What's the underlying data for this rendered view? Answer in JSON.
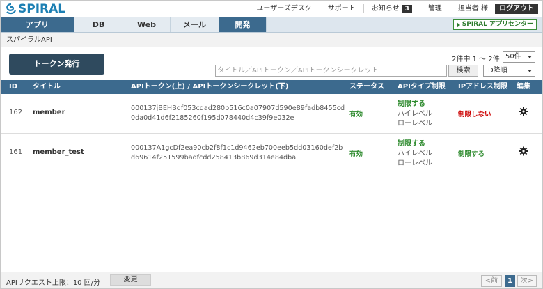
{
  "header": {
    "logo_text": "SPIRAL",
    "nav": {
      "user_desk": "ユーザーズデスク",
      "support": "サポート",
      "notice": "お知らせ",
      "notice_count": "3",
      "admin": "管理",
      "assignee": "担当者 様",
      "logout": "ログアウト"
    }
  },
  "mainnav": {
    "tabs": [
      {
        "label": "アプリ"
      },
      {
        "label": "DB"
      },
      {
        "label": "Web"
      },
      {
        "label": "メール"
      },
      {
        "label": "開発"
      }
    ],
    "app_center": "SPIRAL アプリセンター"
  },
  "breadcrumb": "スパイラルAPI",
  "toolbar": {
    "issue_token": "トークン発行",
    "count_text": "2件中 1 ～ 2件",
    "per_page": "50件",
    "search_placeholder": "タイトル／APIトークン／APIトークンシークレット",
    "search_button": "検索",
    "sort": "ID降順"
  },
  "table": {
    "headers": {
      "id": "ID",
      "title": "タイトル",
      "token": "APIトークン(上) / APIトークンシークレット(下)",
      "status": "ステータス",
      "api_type": "APIタイプ制限",
      "ip": "IPアドレス制限",
      "edit": "編集"
    },
    "rows": [
      {
        "id": "162",
        "title": "member",
        "token": "000137jBEHBdf053cdad280b516c0a07907d590e89fadb8455cd",
        "secret": "0da0d41d6f2185260f195d078440d4c39f9e032e",
        "status": "有効",
        "api_type_1": "制限する",
        "api_type_2": "ハイレベル",
        "api_type_3": "ローレベル",
        "ip": "制限しない",
        "ip_color": "#cc0000"
      },
      {
        "id": "161",
        "title": "member_test",
        "token": "000137A1gcDf2ea90cb2f8f1c1d9462eb700eeb5dd03160def2b",
        "secret": "d69614f251599badfcdd258413b869d314e84dba",
        "status": "有効",
        "api_type_1": "制限する",
        "api_type_2": "ハイレベル",
        "api_type_3": "ローレベル",
        "ip": "制限する",
        "ip_color": "#2d8a2d"
      }
    ]
  },
  "footer": {
    "limit": "APIリクエスト上限：10 回/分",
    "change": "変更",
    "prev": "<前",
    "page": "1",
    "next": "次>"
  },
  "colors": {
    "accent": "#3c6a8e",
    "button_dark": "#2f4a5e",
    "logo": "#1c7fb3",
    "ok_green": "#2d8a2d"
  }
}
